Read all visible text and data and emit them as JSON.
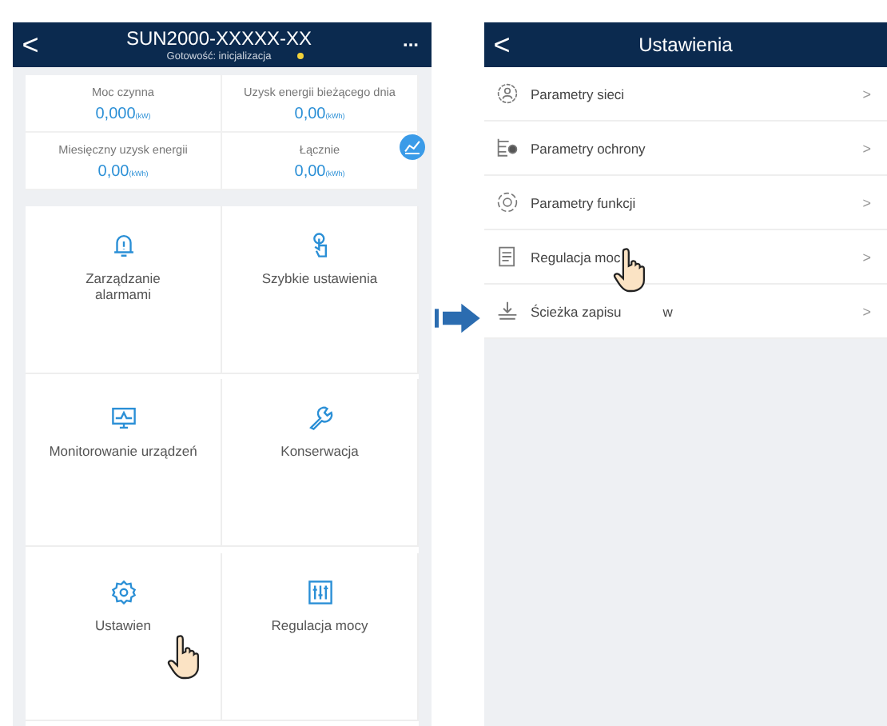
{
  "left_screen": {
    "header": {
      "back": "<",
      "title": "SUN2000-XXXXX-XX",
      "status": "Gotowość: inicjalizacja",
      "more": "..."
    },
    "stats": [
      {
        "label": "Moc czynna",
        "value": "0,000",
        "unit": "(kW)"
      },
      {
        "label": "Uzysk energii bieżącego dnia",
        "value": "0,00",
        "unit": "(kWh)"
      },
      {
        "label": "Miesięczny uzysk energii",
        "value": "0,00",
        "unit": "(kWh)"
      },
      {
        "label": "Łącznie",
        "value": "0,00",
        "unit": "(kWh)"
      }
    ],
    "tiles": [
      {
        "kind": "bell",
        "label": "Zarządzanie alarmami"
      },
      {
        "kind": "touch",
        "label": "Szybkie ustawienia"
      },
      {
        "kind": "monitor",
        "label": "Monitorowanie urządzeń"
      },
      {
        "kind": "wrench",
        "label": "Konserwacja"
      },
      {
        "kind": "gear",
        "label": "Ustawien",
        "pointer": true
      },
      {
        "kind": "sliders",
        "label": "Regulacja mocy"
      }
    ]
  },
  "right_screen": {
    "header": {
      "back": "<",
      "title": "Ustawienia"
    },
    "items": [
      {
        "kind": "grid",
        "label": "Parametry sieci",
        "chevron": ">"
      },
      {
        "kind": "protect",
        "label": "Parametry ochrony",
        "chevron": ">"
      },
      {
        "kind": "function",
        "label": "Parametry funkcji",
        "chevron": ">"
      },
      {
        "kind": "power",
        "label": "Regulacja moc",
        "chevron": ">",
        "pointer": true
      },
      {
        "kind": "download",
        "label": "Ścieżka zapisu",
        "label_tail": "w",
        "chevron": ">"
      }
    ]
  }
}
